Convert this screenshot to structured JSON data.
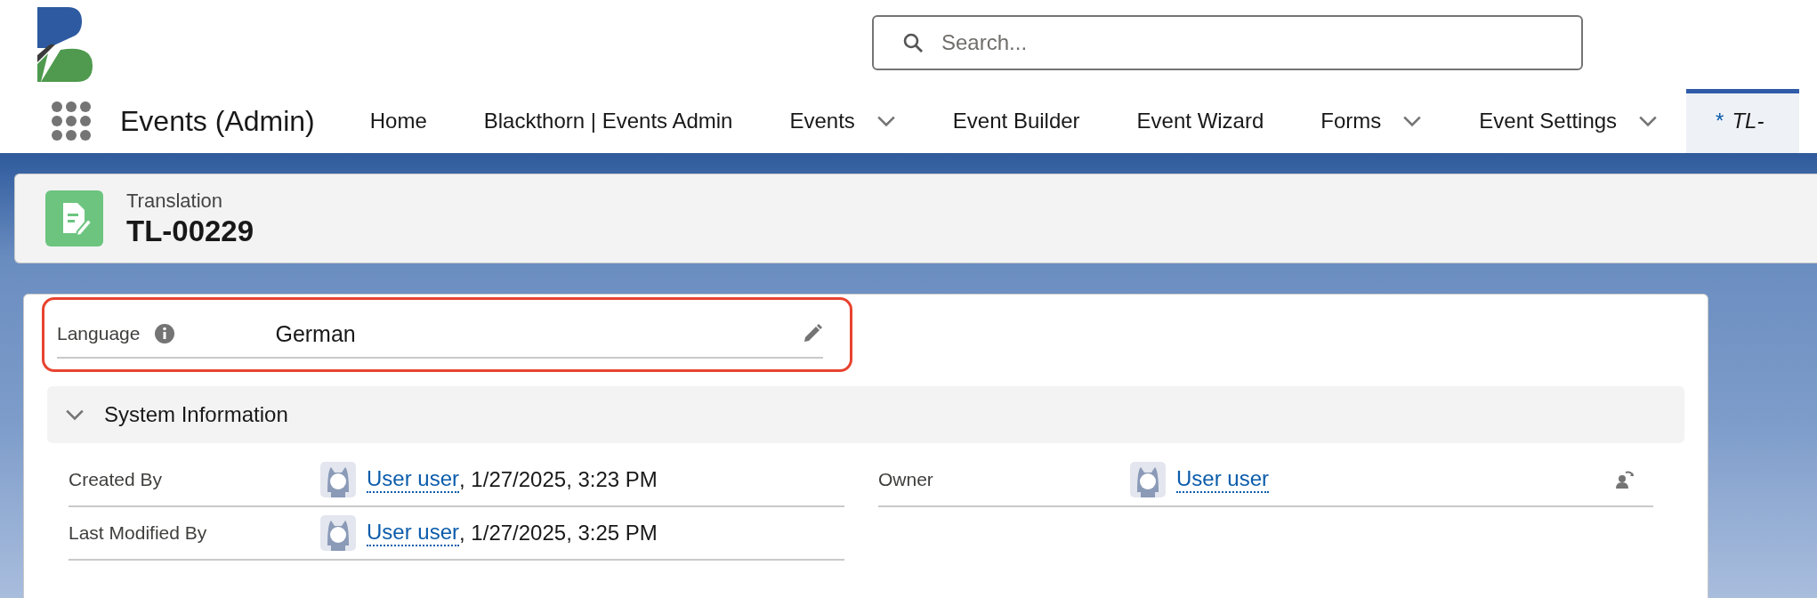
{
  "search": {
    "placeholder": "Search..."
  },
  "app_name": "Events (Admin)",
  "nav": [
    {
      "label": "Home",
      "kind": "link",
      "selected": false
    },
    {
      "label": "Blackthorn | Events Admin",
      "kind": "link",
      "selected": false
    },
    {
      "label": "Events",
      "kind": "menu",
      "selected": false
    },
    {
      "label": "Event Builder",
      "kind": "link",
      "selected": false
    },
    {
      "label": "Event Wizard",
      "kind": "link",
      "selected": false
    },
    {
      "label": "Forms",
      "kind": "menu",
      "selected": false
    },
    {
      "label": "Event Settings",
      "kind": "menu",
      "selected": false
    },
    {
      "label": "TL-",
      "kind": "tab",
      "unsaved_mark": "*",
      "selected": true
    }
  ],
  "record": {
    "object_type": "Translation",
    "name": "TL-00229"
  },
  "fields": [
    {
      "label": "Language",
      "value": "German",
      "highlighted": true
    }
  ],
  "sections": [
    {
      "title": "System Information",
      "expanded": true,
      "columns": [
        [
          {
            "label": "Created By",
            "kind": "audit",
            "user": "User user",
            "suffix": ", 1/27/2025, 3:23 PM"
          },
          {
            "label": "Last Modified By",
            "kind": "audit",
            "user": "User user",
            "suffix": ", 1/27/2025, 3:25 PM"
          }
        ],
        [
          {
            "label": "Owner",
            "kind": "owner",
            "user": "User user"
          }
        ]
      ]
    }
  ]
}
